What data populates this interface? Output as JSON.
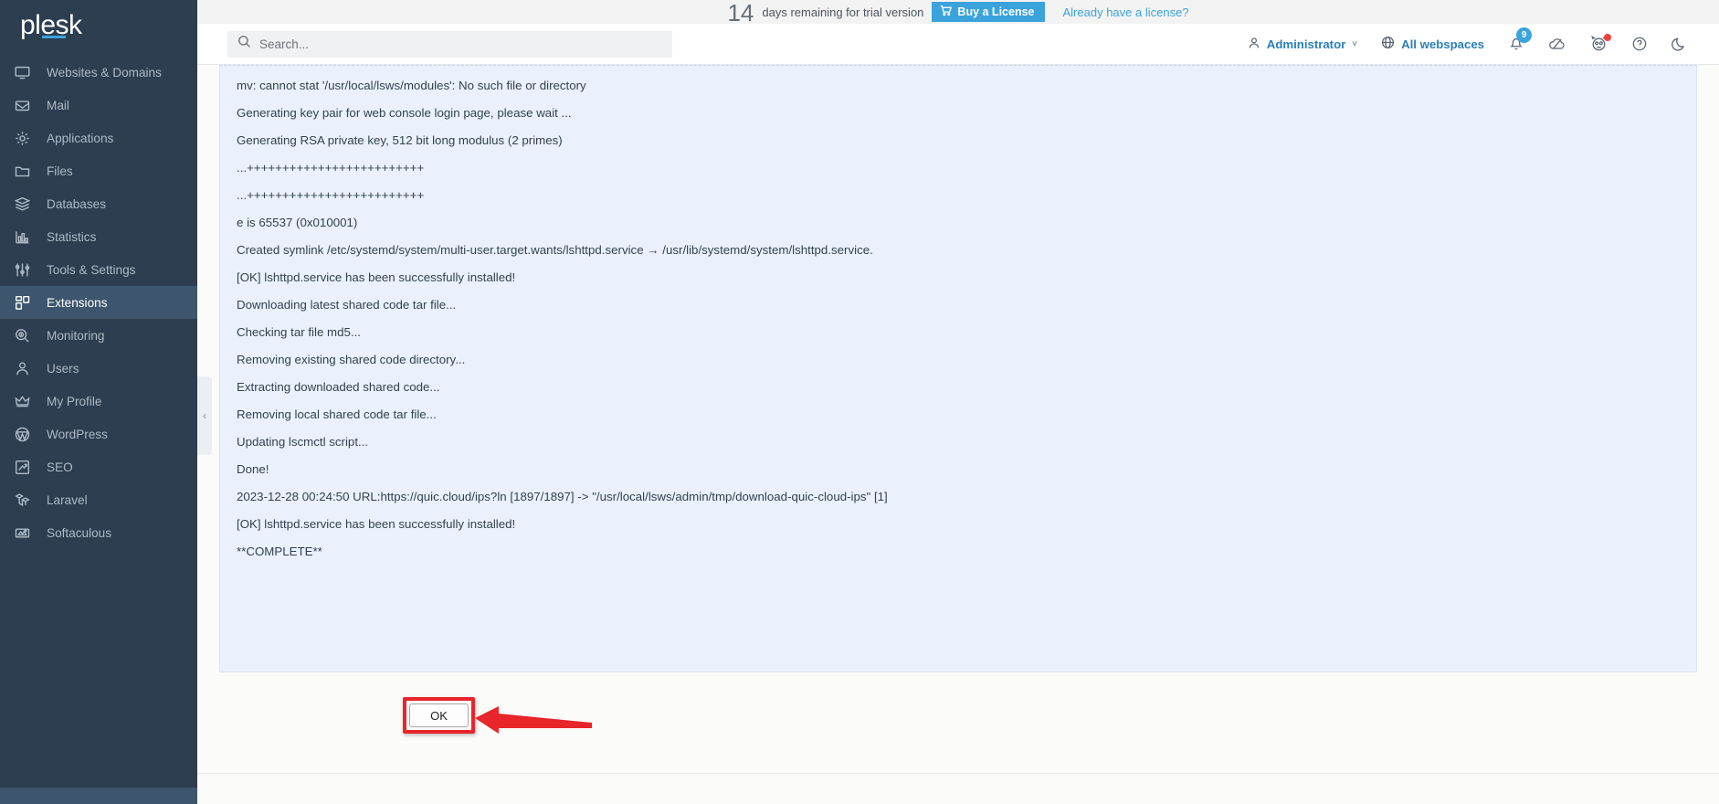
{
  "brand": {
    "name": "plesk"
  },
  "sidebar": {
    "items": [
      {
        "label": "Websites & Domains",
        "icon": "monitor-icon",
        "active": false
      },
      {
        "label": "Mail",
        "icon": "mail-icon",
        "active": false
      },
      {
        "label": "Applications",
        "icon": "gear-icon",
        "active": false
      },
      {
        "label": "Files",
        "icon": "folder-icon",
        "active": false
      },
      {
        "label": "Databases",
        "icon": "database-icon",
        "active": false
      },
      {
        "label": "Statistics",
        "icon": "bar-chart-icon",
        "active": false
      },
      {
        "label": "Tools & Settings",
        "icon": "sliders-icon",
        "active": false
      },
      {
        "label": "Extensions",
        "icon": "extensions-icon",
        "active": true
      },
      {
        "label": "Monitoring",
        "icon": "monitoring-icon",
        "active": false
      },
      {
        "label": "Users",
        "icon": "user-icon",
        "active": false
      },
      {
        "label": "My Profile",
        "icon": "crown-icon",
        "active": false
      },
      {
        "label": "WordPress",
        "icon": "wordpress-icon",
        "active": false
      },
      {
        "label": "SEO",
        "icon": "seo-trend-icon",
        "active": false
      },
      {
        "label": "Laravel",
        "icon": "laravel-icon",
        "active": false
      },
      {
        "label": "Softaculous",
        "icon": "softaculous-icon",
        "active": false
      }
    ],
    "collapse_chevron": "‹"
  },
  "trial": {
    "days": "14",
    "text": "days remaining for trial version",
    "buy_label": "Buy a License",
    "already_label": "Already have a license?"
  },
  "search": {
    "placeholder": "Search...",
    "value": ""
  },
  "header": {
    "user": "Administrator",
    "user_chevron": "˅",
    "workspaces": "All webspaces",
    "notifications_count": "9"
  },
  "console": {
    "lines": [
      "mv: cannot stat '/usr/local/lsws/modules': No such file or directory",
      "Generating key pair for web console login page, please wait ...",
      "Generating RSA private key, 512 bit long modulus (2 primes)",
      "...+++++++++++++++++++++++++",
      "...+++++++++++++++++++++++++",
      "e is 65537 (0x010001)",
      "Created symlink /etc/systemd/system/multi-user.target.wants/lshttpd.service → /usr/lib/systemd/system/lshttpd.service.",
      "[OK] lshttpd.service has been successfully installed!",
      "Downloading latest shared code tar file...",
      "Checking tar file md5...",
      "Removing existing shared code directory...",
      "Extracting downloaded shared code...",
      "Removing local shared code tar file...",
      "Updating lscmctl script...",
      "Done!",
      "2023-12-28 00:24:50 URL:https://quic.cloud/ips?ln [1897/1897] -> \"/usr/local/lsws/admin/tmp/download-quic-cloud-ips\" [1]",
      "[OK] lshttpd.service has been successfully installed!",
      "**COMPLETE**"
    ]
  },
  "actions": {
    "ok_label": "OK"
  },
  "colors": {
    "sidebar_bg": "#2c3e50",
    "sidebar_active": "#3d566e",
    "accent_blue": "#3ba3dc",
    "link_blue": "#2a7fba",
    "console_bg": "#eaf1fc",
    "annotation_red": "#e8252a"
  }
}
